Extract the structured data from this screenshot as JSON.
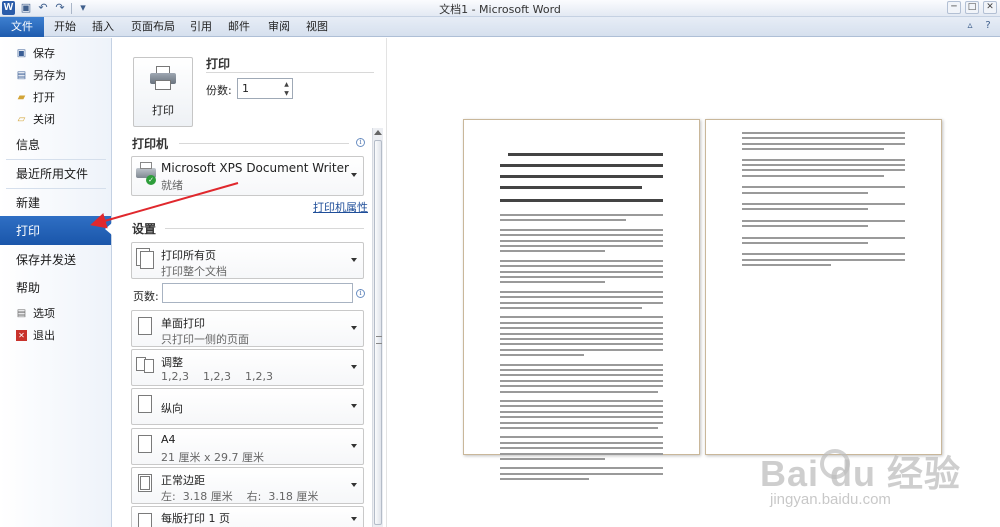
{
  "window": {
    "title": "文档1 - Microsoft Word",
    "app_icon": "W",
    "qat_icons": [
      "save-icon",
      "undo-icon",
      "redo-icon",
      "customize-icon"
    ],
    "controls": [
      "─",
      "□",
      "✕"
    ]
  },
  "ribbon": {
    "tabs": [
      "文件",
      "开始",
      "插入",
      "页面布局",
      "引用",
      "邮件",
      "审阅",
      "视图"
    ],
    "active_tab": "文件",
    "right_icons": [
      "▵",
      "?"
    ]
  },
  "nav": {
    "save": "保存",
    "save_as": "另存为",
    "open": "打开",
    "close": "关闭",
    "info": "信息",
    "recent": "最近所用文件",
    "new": "新建",
    "print": "打印",
    "save_send": "保存并发送",
    "help": "帮助",
    "options": "选项",
    "exit": "退出",
    "active": "打印"
  },
  "print_panel": {
    "heading": "打印",
    "print_button": "打印",
    "copies_label": "份数:",
    "copies_value": "1",
    "printer_heading": "打印机",
    "printer_name": "Microsoft XPS Document Writer",
    "printer_status": "就绪",
    "printer_props_link": "打印机属性",
    "settings_heading": "设置",
    "range": {
      "title": "打印所有页",
      "sub": "打印整个文档"
    },
    "pages_label": "页数:",
    "pages_value": "",
    "sides": {
      "title": "单面打印",
      "sub": "只打印一侧的页面"
    },
    "collate": {
      "title": "调整",
      "sub": "1,2,3    1,2,3    1,2,3"
    },
    "orientation": {
      "title": "纵向"
    },
    "paper": {
      "title": "A4",
      "sub": "21 厘米 x 29.7 厘米"
    },
    "margins": {
      "title": "正常边距",
      "sub": "左:  3.18 厘米    右:  3.18 厘米"
    },
    "per_page": {
      "title": "每版打印 1 页"
    }
  },
  "preview": {
    "pages_shown": 2
  },
  "watermark": {
    "main": "Bai du 经验",
    "sub": "jingyan.baidu.com"
  },
  "colors": {
    "accent": "#1f5cae",
    "annotation_arrow": "#e0282d"
  }
}
